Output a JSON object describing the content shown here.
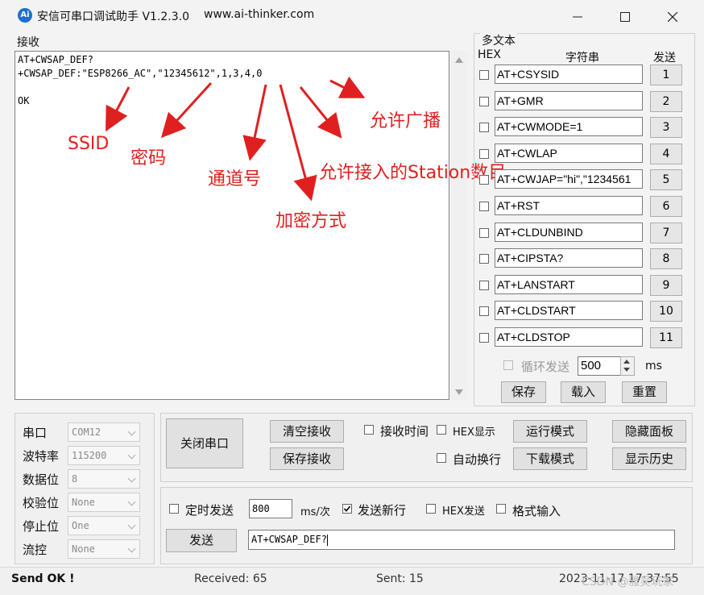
{
  "window": {
    "app_icon_text": "Ai",
    "title": "安信可串口调试助手 V1.2.3.0",
    "url": "www.ai-thinker.com"
  },
  "receive": {
    "group_label": "接收",
    "lines": [
      "AT+CWSAP_DEF?",
      "+CWSAP_DEF:\"ESP8266_AC\",\"12345612\",1,3,4,0",
      "",
      "OK"
    ]
  },
  "annotations": {
    "ssid": "SSID",
    "password": "密码",
    "channel": "通道号",
    "encryption": "加密方式",
    "max_conn": "允许接入的Station数目",
    "broadcast": "允许广播"
  },
  "multi_text": {
    "group_label": "多文本",
    "col_hex": "HEX",
    "col_string": "字符串",
    "col_send": "发送",
    "rows": [
      {
        "cmd": "AT+CSYSID",
        "num": "1"
      },
      {
        "cmd": "AT+GMR",
        "num": "2"
      },
      {
        "cmd": "AT+CWMODE=1",
        "num": "3"
      },
      {
        "cmd": "AT+CWLAP",
        "num": "4"
      },
      {
        "cmd": "AT+CWJAP=\"hi\",\"1234561",
        "num": "5"
      },
      {
        "cmd": "AT+RST",
        "num": "6"
      },
      {
        "cmd": "AT+CLDUNBIND",
        "num": "7"
      },
      {
        "cmd": "AT+CIPSTA?",
        "num": "8"
      },
      {
        "cmd": "AT+LANSTART",
        "num": "9"
      },
      {
        "cmd": "AT+CLDSTART",
        "num": "10"
      },
      {
        "cmd": "AT+CLDSTOP",
        "num": "11"
      }
    ],
    "loop_send_label": "循环发送",
    "loop_interval": "500",
    "loop_unit": "ms",
    "save_label": "保存",
    "load_label": "载入",
    "reset_label": "重置"
  },
  "serial": {
    "port_label": "串口",
    "port_value": "COM12",
    "baud_label": "波特率",
    "baud_value": "115200",
    "databits_label": "数据位",
    "databits_value": "8",
    "parity_label": "校验位",
    "parity_value": "None",
    "stopbits_label": "停止位",
    "stopbits_value": "One",
    "flow_label": "流控",
    "flow_value": "None"
  },
  "controls": {
    "close_port": "关闭串口",
    "clear_recv": "清空接收",
    "save_recv": "保存接收",
    "recv_time": "接收时间",
    "hex_display": "HEX显示",
    "auto_wrap": "自动换行",
    "run_mode": "运行模式",
    "download_mode": "下载模式",
    "hide_panel": "隐藏面板",
    "show_history": "显示历史"
  },
  "send": {
    "timed_send": "定时发送",
    "interval": "800",
    "interval_unit": "ms/次",
    "send_newline": "发送新行",
    "hex_send": "HEX发送",
    "format_input": "格式输入",
    "send_button": "发送",
    "input_value": "AT+CWSAP_DEF?"
  },
  "status": {
    "message": "Send OK !",
    "received": "Received: 65",
    "sent": "Sent: 15",
    "time": "2023-11-17 17:37:55",
    "watermark": "CSDN @雅吴玩家"
  },
  "colors": {
    "annotation": "#e02020",
    "app_icon": "#1e6fd0"
  }
}
